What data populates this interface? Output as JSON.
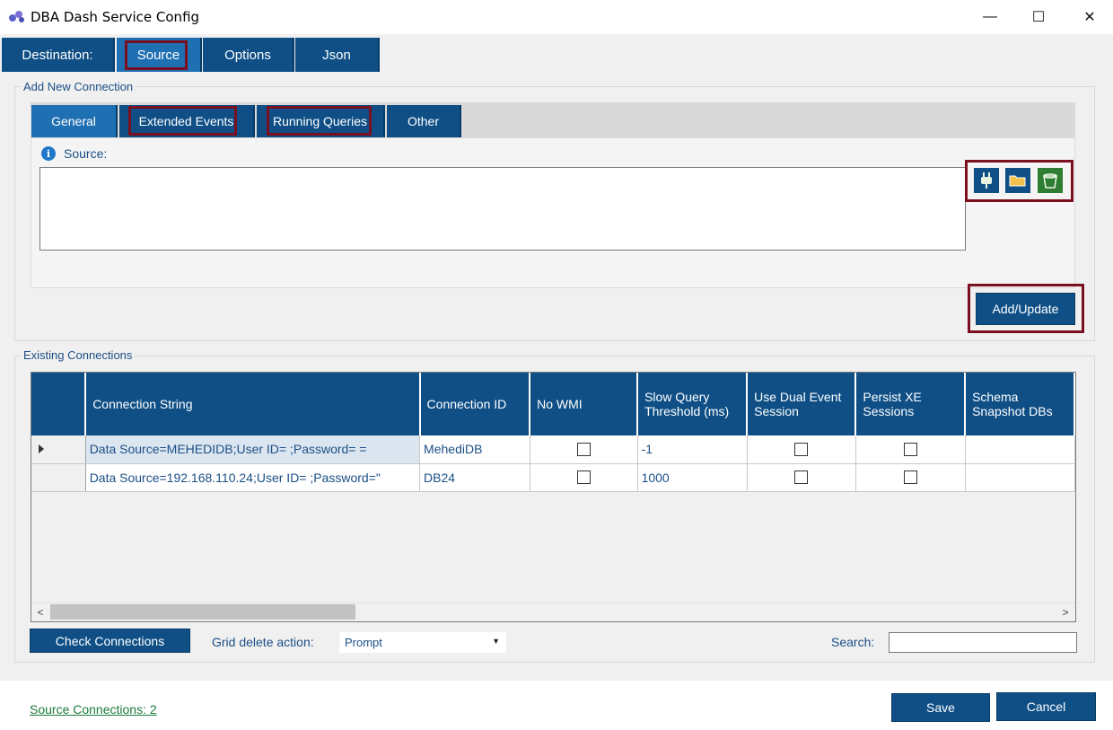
{
  "window": {
    "title": "DBA Dash Service Config",
    "app_icon": "gear-cluster-icon",
    "controls": {
      "minimize": "—",
      "maximize": "☐",
      "close": "✕"
    }
  },
  "main_tabs": [
    {
      "label": "Destination:",
      "active": false
    },
    {
      "label": "Source",
      "active": true
    },
    {
      "label": "Options",
      "active": false
    },
    {
      "label": "Json",
      "active": false
    }
  ],
  "add_connection": {
    "group_label": "Add New Connection",
    "tabs": [
      {
        "label": "General",
        "active": true
      },
      {
        "label": "Extended Events",
        "active": false
      },
      {
        "label": "Running Queries",
        "active": false
      },
      {
        "label": "Other",
        "active": false
      }
    ],
    "source_label": "Source:",
    "source_value": "",
    "icon_buttons": [
      "connect-plug-icon",
      "folder-open-icon",
      "s3-bucket-icon"
    ],
    "add_update_label": "Add/Update"
  },
  "existing_connections": {
    "group_label": "Existing Connections",
    "columns": [
      "Connection String",
      "Connection ID",
      "No WMI",
      "Slow Query Threshold (ms)",
      "Use Dual Event Session",
      "Persist XE Sessions",
      "Schema Snapshot DBs"
    ],
    "rows": [
      {
        "connection_string": "Data Source=MEHEDIDB;User ID=  ;Password=  =",
        "connection_id": "MehediDB",
        "no_wmi": false,
        "slow_query": "-1",
        "dual_event": false,
        "persist_xe": false,
        "schema_dbs": ""
      },
      {
        "connection_string": "Data Source=192.168.110.24;User ID=   ;Password=\"",
        "connection_id": "DB24",
        "no_wmi": false,
        "slow_query": "1000",
        "dual_event": false,
        "persist_xe": false,
        "schema_dbs": ""
      }
    ],
    "check_connections_label": "Check Connections",
    "grid_delete_label": "Grid delete action:",
    "grid_delete_value": "Prompt",
    "search_label": "Search:",
    "search_value": ""
  },
  "footer": {
    "status_link": "Source Connections: 2",
    "save_label": "Save",
    "cancel_label": "Cancel"
  },
  "colors": {
    "tab_blue": "#0f4f86",
    "tab_active": "#1f6fb3",
    "highlight_box": "#7a0f1f",
    "label_blue": "#1b4f86"
  }
}
